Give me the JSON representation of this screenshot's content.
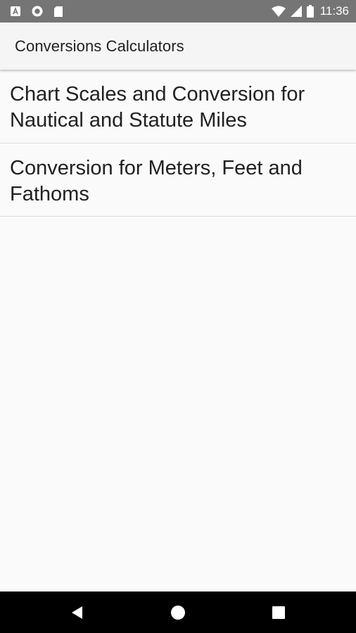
{
  "status_bar": {
    "time": "11:36",
    "left_icons": [
      "a-notification-icon",
      "circle-notification-icon",
      "sd-card-icon"
    ],
    "right_icons": [
      "wifi-icon",
      "cell-signal-icon",
      "battery-icon"
    ]
  },
  "app_bar": {
    "title": "Conversions Calculators"
  },
  "list": {
    "items": [
      {
        "label": "Chart Scales and Conversion for Nautical and Statute Miles"
      },
      {
        "label": "Conversion for Meters, Feet and Fathoms"
      }
    ]
  },
  "nav_bar": {
    "buttons": [
      "back-icon",
      "home-icon",
      "recents-icon"
    ]
  },
  "colors": {
    "status_bar": "#757575",
    "app_bar": "#f5f5f5",
    "background": "#fafafa",
    "divider": "#dcdcdc",
    "nav_bar": "#000000"
  }
}
